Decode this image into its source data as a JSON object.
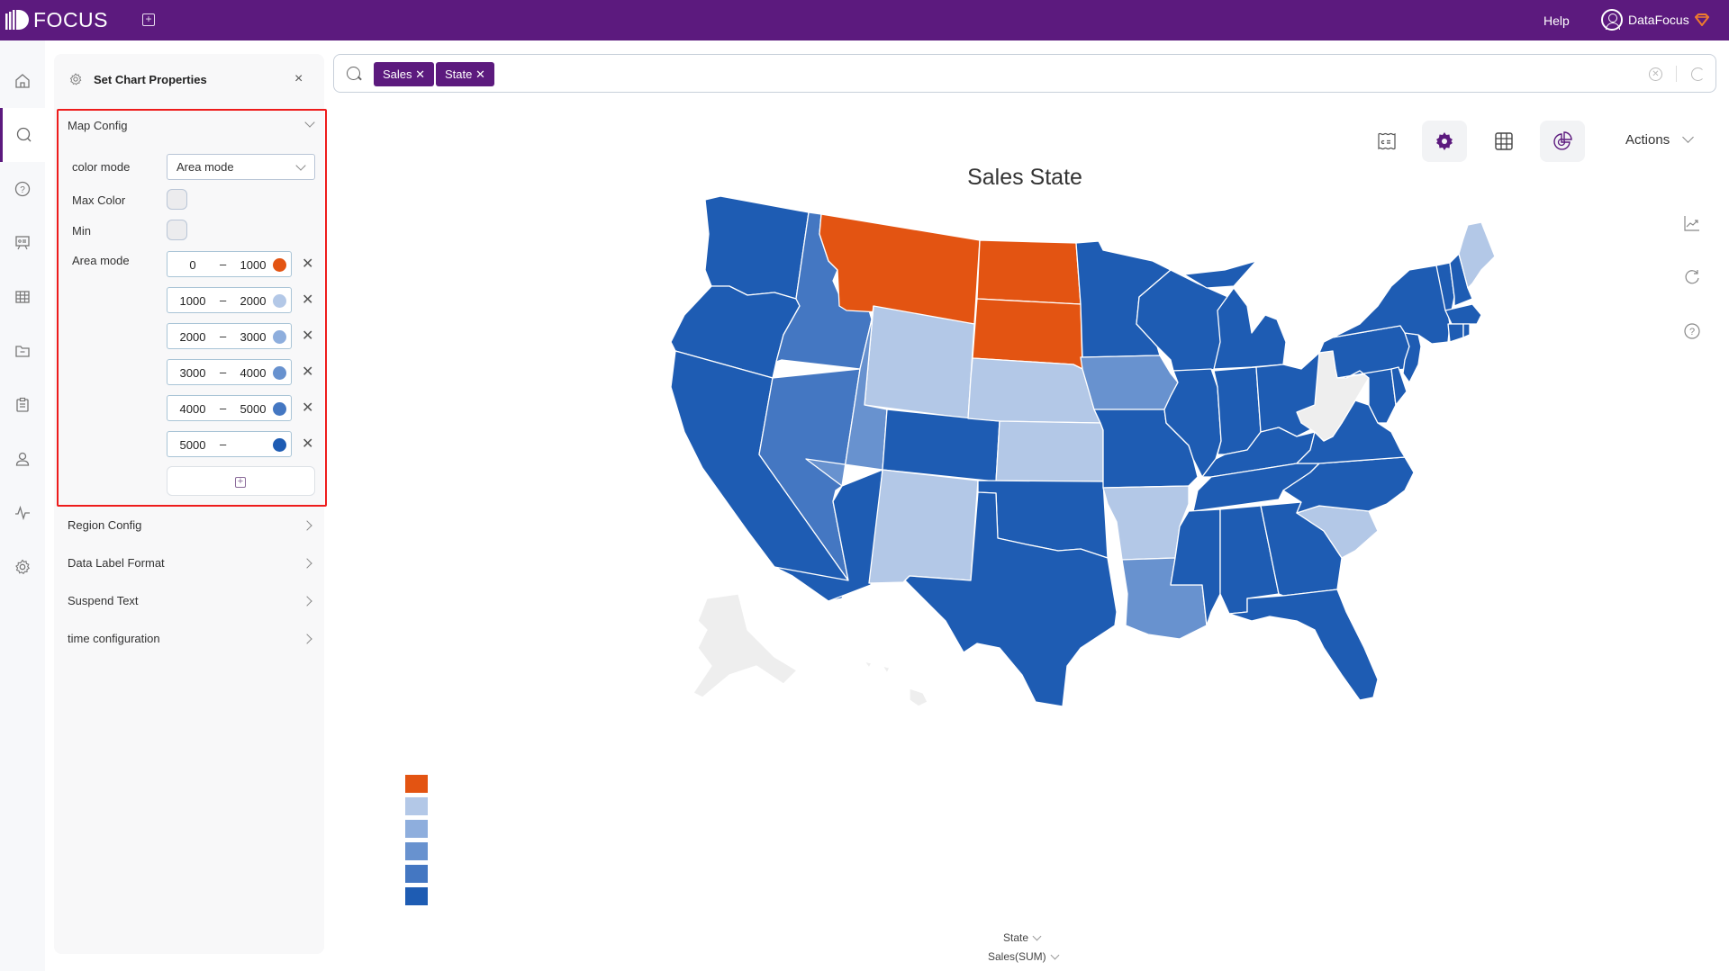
{
  "app": {
    "logo_text": "FOCUS",
    "help_label": "Help",
    "user_name": "DataFocus",
    "accent_color": "#5c1a7e"
  },
  "leftnav": {
    "items": [
      {
        "name": "home",
        "icon": "home-icon",
        "active": false
      },
      {
        "name": "search",
        "icon": "search-icon",
        "active": true
      },
      {
        "name": "help",
        "icon": "question-icon",
        "active": false
      },
      {
        "name": "dashboard",
        "icon": "presentation-icon",
        "active": false
      },
      {
        "name": "tables",
        "icon": "table-icon",
        "active": false
      },
      {
        "name": "files",
        "icon": "folder-icon",
        "active": false
      },
      {
        "name": "tasks",
        "icon": "clipboard-icon",
        "active": false
      },
      {
        "name": "users",
        "icon": "user-icon",
        "active": false
      },
      {
        "name": "monitor",
        "icon": "pulse-icon",
        "active": false
      },
      {
        "name": "settings",
        "icon": "gear-icon",
        "active": false
      }
    ]
  },
  "panel": {
    "title": "Set Chart Properties",
    "map_config": {
      "title": "Map Config",
      "color_mode_label": "color mode",
      "color_mode_value": "Area mode",
      "max_color_label": "Max Color",
      "min_label": "Min",
      "area_mode_label": "Area mode",
      "ranges": [
        {
          "from": "0",
          "to": "1000",
          "color": "#e35412"
        },
        {
          "from": "1000",
          "to": "2000",
          "color": "#b3c8e7"
        },
        {
          "from": "2000",
          "to": "3000",
          "color": "#8eaedd"
        },
        {
          "from": "3000",
          "to": "4000",
          "color": "#6892cf"
        },
        {
          "from": "4000",
          "to": "5000",
          "color": "#4477c2"
        },
        {
          "from": "5000",
          "to": "",
          "color": "#1e5cb3"
        }
      ]
    },
    "sections": [
      {
        "title": "Region Config"
      },
      {
        "title": "Data Label Format"
      },
      {
        "title": "Suspend Text"
      },
      {
        "title": "time configuration"
      }
    ]
  },
  "search": {
    "tokens": [
      "Sales",
      "State"
    ]
  },
  "toolbar": {
    "actions_label": "Actions"
  },
  "chart_data": {
    "type": "choropleth-map",
    "title": "Sales State",
    "region": "USA",
    "color_mode": "Area mode",
    "bins": [
      {
        "range": [
          0,
          1000
        ],
        "color": "#e35412",
        "states": [
          "Montana",
          "North Dakota",
          "South Dakota"
        ]
      },
      {
        "range": [
          1000,
          2000
        ],
        "color": "#b3c8e7",
        "states": [
          "Wyoming",
          "Nebraska",
          "Kansas",
          "New Mexico",
          "Arkansas",
          "South Carolina",
          "Maine"
        ]
      },
      {
        "range": [
          2000,
          3000
        ],
        "color": "#8eaedd",
        "states": []
      },
      {
        "range": [
          3000,
          4000
        ],
        "color": "#6892cf",
        "states": [
          "Utah",
          "Iowa",
          "Louisiana"
        ]
      },
      {
        "range": [
          4000,
          5000
        ],
        "color": "#4477c2",
        "states": [
          "Idaho",
          "Nevada"
        ]
      },
      {
        "range": [
          5000,
          null
        ],
        "color": "#1e5cb3",
        "states": [
          "Washington",
          "Oregon",
          "California",
          "Arizona",
          "Colorado",
          "Texas",
          "Oklahoma",
          "Minnesota",
          "Wisconsin",
          "Michigan",
          "Illinois",
          "Missouri",
          "Indiana",
          "Ohio",
          "Kentucky",
          "Tennessee",
          "Mississippi",
          "Alabama",
          "Georgia",
          "Florida",
          "North Carolina",
          "Virginia",
          "Pennsylvania",
          "New York",
          "New Jersey",
          "Maryland",
          "Delaware",
          "Vermont",
          "New Hampshire",
          "Massachusetts",
          "Connecticut",
          "Rhode Island"
        ]
      }
    ],
    "no_data_states": [
      "West Virginia",
      "Alaska",
      "Hawaii"
    ],
    "no_data_color": "#eeeeee",
    "x_field": "State",
    "y_field": "Sales(SUM)"
  }
}
